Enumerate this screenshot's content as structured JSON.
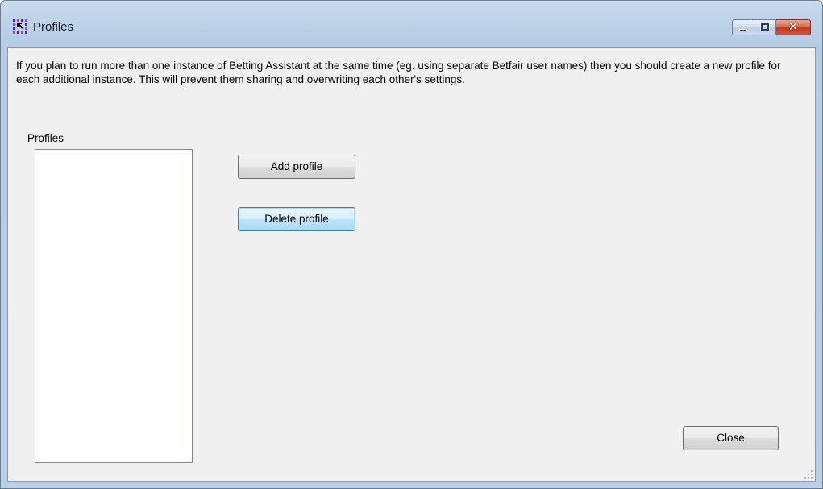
{
  "window": {
    "title": "Profiles"
  },
  "main": {
    "description": "If you plan to run more than one instance of Betting Assistant at the same time (eg. using separate Betfair user names) then you should create a new profile for each additional instance. This will prevent them sharing and overwriting each other's settings.",
    "profiles_label": "Profiles",
    "profiles_items": [],
    "add_profile_label": "Add profile",
    "delete_profile_label": "Delete profile",
    "close_label": "Close"
  },
  "icons": {
    "app": "betting-assistant-icon",
    "minimize": "minimize-icon",
    "maximize": "maximize-icon",
    "close": "close-icon",
    "grip": "resize-grip-icon"
  },
  "colors": {
    "titlebar": "#bcd1e8",
    "client_background": "#f0f0f0",
    "close_button": "#c0391a",
    "focus_button": "#a7d9f5"
  }
}
